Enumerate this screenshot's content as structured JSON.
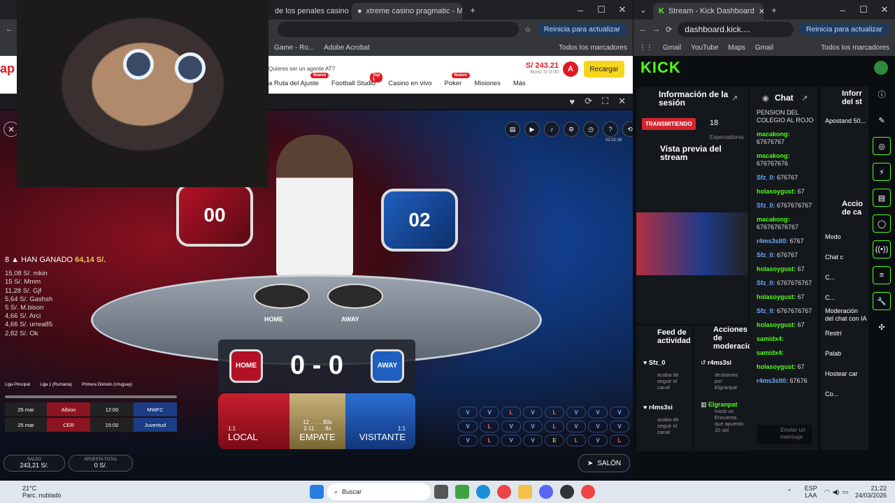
{
  "left_browser": {
    "tabs": [
      "de los penales casino - N",
      "xtreme casino pragmatic - Mas"
    ],
    "update_button": "Reinicia para actualizar",
    "bookmarks": [
      "Game - Ro...",
      "Adobe Acrobat",
      "Todos los marcadores"
    ],
    "site": {
      "balance": "S/ 243.21",
      "bono": "Bono S/ 0.00",
      "avatar": "A",
      "recharge": "Recargar",
      "agent_question": "Quieres ser un agente AT?",
      "nav": [
        {
          "label": "a Ruta del Ajuste",
          "badge": "Nuevo"
        },
        {
          "label": "Football Studio",
          "badge": "Top 1"
        },
        {
          "label": "Casino en vivo",
          "badge": ""
        },
        {
          "label": "Poker",
          "badge": "Nuevo"
        },
        {
          "label": "Misiones",
          "badge": ""
        },
        {
          "label": "Más",
          "badge": ""
        }
      ]
    }
  },
  "game": {
    "timer": "02:22:38",
    "badge_left": "00",
    "badge_right": "02",
    "home_label": "HOME",
    "away_label": "AWAY",
    "score": "0 - 0",
    "winners_title": "HAN GANADO",
    "winners_total": "64,14 S/.",
    "winners_count": "8",
    "winners": [
      "15,08 S/. mkin",
      "15 S/. Mmm",
      "11,28 S/. Gjf",
      "5,64 S/. Gashsh",
      "5 S/. M.bison",
      "4,66 S/. Arci",
      "4,66 S/. urrea85",
      "2,82 S/. Ok"
    ],
    "local": {
      "odds": "1:1",
      "label": "LOCAL"
    },
    "draw": {
      "odds1": "12 . . . . 80x",
      "odds2": "2-11 . . . 8x",
      "label": "EMPATE"
    },
    "visitor": {
      "odds": "1:1",
      "label": "VISITANTE"
    },
    "leagues": [
      "Liga Principal",
      "Liga 1 (Rumania)",
      "Primera División (Uruguay)"
    ],
    "schedule": [
      {
        "date": "25 mar",
        "home": "Albion",
        "time": "12:00",
        "away": "MWFC"
      },
      {
        "date": "25 mar",
        "home": "CER",
        "time": "15:00",
        "away": "Juventud"
      }
    ],
    "road": [
      "V",
      "V",
      "L",
      "V",
      "L",
      "V",
      "V",
      "V",
      "V",
      "L",
      "V",
      "V",
      "L",
      "V",
      "V",
      "V",
      "V",
      "L",
      "V",
      "V",
      "E",
      "L",
      "V",
      "L"
    ],
    "saldo_label": "SALDO",
    "saldo": "243,21 S/.",
    "apuesta_label": "APUESTA TOTAL",
    "apuesta": "0 S/.",
    "salon": "SALÓN"
  },
  "right_browser": {
    "tab": "Stream - Kick Dashboard",
    "url": "dashboard.kick....",
    "update_button": "Reinicia para actualizar",
    "bookmarks": [
      "Gmail",
      "YouTube",
      "Maps",
      "Gmail",
      "Todos los marcadores"
    ],
    "logo": "KICK",
    "session_title": "Información de la sesión",
    "live": "TRANSMITIENDO",
    "viewers": "18",
    "viewers_label": "Espectadores",
    "preview_title": "Vista previa del stream",
    "chat_title": "Chat",
    "chat": [
      {
        "user": "",
        "text": "PENSION DEL COLEGIO AL ROJO"
      },
      {
        "user": "macakong:",
        "text": "67676767"
      },
      {
        "user": "macakong:",
        "text": "676767676"
      },
      {
        "user": "Sfz_0:",
        "text": "676767"
      },
      {
        "user": "holasoygust:",
        "text": "67"
      },
      {
        "user": "Sfz_0:",
        "text": "6767676767"
      },
      {
        "user": "macakong:",
        "text": "676767676767"
      },
      {
        "user": "r4ms3slt0:",
        "text": "6767"
      },
      {
        "user": "Sfz_0:",
        "text": "676767"
      },
      {
        "user": "holasoygust:",
        "text": "67"
      },
      {
        "user": "Sfz_0:",
        "text": "6767676767"
      },
      {
        "user": "holasoygust:",
        "text": "67"
      },
      {
        "user": "Sfz_0:",
        "text": "6767676767"
      },
      {
        "user": "holasoygust:",
        "text": "67"
      },
      {
        "user": "samidx4:",
        "text": ""
      },
      {
        "user": "samidx4:",
        "text": ""
      },
      {
        "user": "holasoygust:",
        "text": "67"
      },
      {
        "user": "r4ms3slt0:",
        "text": "67676"
      }
    ],
    "chat_placeholder": "Enviar un mensaje",
    "feed_title": "Feed de actividad",
    "feed": [
      {
        "user": "Sfz_0",
        "text": "acaba de seguir el canal"
      },
      {
        "user": "r4ms3si",
        "text": "acaba de seguir el canal"
      }
    ],
    "mod_title": "Acciones de moderación",
    "mod": [
      {
        "user": "r4ms3si",
        "text": "desbanea por Elgranpat"
      },
      {
        "user": "Elgranpat",
        "text": "inició un Encuesta que apuesto 10 sol"
      }
    ],
    "info_title": "Inforr del st",
    "info_text": "Apostand 50...",
    "actions_title": "Accio de ca",
    "actions": [
      "Modo",
      "Chat c",
      "C...",
      "C...",
      "Moderación del chat con IA",
      "Restri",
      "Palab",
      "Hostear car",
      "Co..."
    ]
  },
  "taskbar": {
    "weather_temp": "21°C",
    "weather_desc": "Parc. nublado",
    "search": "Buscar",
    "lang": "ESP",
    "lang2": "LAA",
    "time": "21:22",
    "date": "24/03/2026"
  }
}
